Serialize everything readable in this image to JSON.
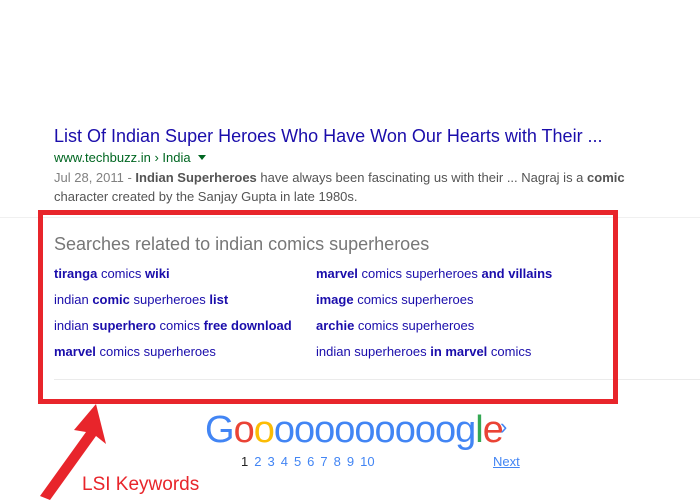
{
  "result": {
    "title": "List Of Indian Super Heroes Who Have Won Our Hearts with Their ...",
    "url_domain": "www.techbuzz.in",
    "url_path": "India",
    "date": "Jul 28, 2011 - ",
    "snippet_parts": [
      {
        "t": "Indian Superheroes",
        "b": true
      },
      {
        "t": " have always been fascinating us with their ... Nagraj is a ",
        "b": false
      },
      {
        "t": "comic",
        "b": true
      },
      {
        "t": " character created by the Sanjay Gupta in late 1980s.",
        "b": false
      }
    ]
  },
  "related": {
    "title": "Searches related to indian comics superheroes",
    "left": [
      [
        {
          "t": "tiranga",
          "b": true
        },
        {
          "t": " comics ",
          "b": false
        },
        {
          "t": "wiki",
          "b": true
        }
      ],
      [
        {
          "t": "indian ",
          "b": false
        },
        {
          "t": "comic",
          "b": true
        },
        {
          "t": " superheroes ",
          "b": false
        },
        {
          "t": "list",
          "b": true
        }
      ],
      [
        {
          "t": "indian ",
          "b": false
        },
        {
          "t": "superhero",
          "b": true
        },
        {
          "t": " comics ",
          "b": false
        },
        {
          "t": "free download",
          "b": true
        }
      ],
      [
        {
          "t": "marvel",
          "b": true
        },
        {
          "t": " comics superheroes",
          "b": false
        }
      ]
    ],
    "right": [
      [
        {
          "t": "marvel",
          "b": true
        },
        {
          "t": " comics superheroes ",
          "b": false
        },
        {
          "t": "and villains",
          "b": true
        }
      ],
      [
        {
          "t": "image",
          "b": true
        },
        {
          "t": " comics superheroes",
          "b": false
        }
      ],
      [
        {
          "t": "archie",
          "b": true
        },
        {
          "t": " comics superheroes",
          "b": false
        }
      ],
      [
        {
          "t": "indian superheroes ",
          "b": false
        },
        {
          "t": "in marvel",
          "b": true
        },
        {
          "t": " comics",
          "b": false
        }
      ]
    ]
  },
  "pager": {
    "logo_letters": [
      "G",
      "o",
      "o",
      "o",
      "o",
      "o",
      "o",
      "o",
      "o",
      "o",
      "o",
      "o",
      "g",
      "l",
      "e"
    ],
    "logo_colors": [
      "#4285f4",
      "#ea4335",
      "#fbbc05",
      "#4285f4",
      "#4285f4",
      "#4285f4",
      "#4285f4",
      "#4285f4",
      "#4285f4",
      "#4285f4",
      "#4285f4",
      "#4285f4",
      "#4285f4",
      "#34a853",
      "#ea4335"
    ],
    "pages": [
      "1",
      "2",
      "3",
      "4",
      "5",
      "6",
      "7",
      "8",
      "9",
      "10"
    ],
    "current_page": "1",
    "next_chevron": "›",
    "next_label": "Next"
  },
  "annotation": {
    "label": "LSI Keywords",
    "color": "#e8252b"
  }
}
